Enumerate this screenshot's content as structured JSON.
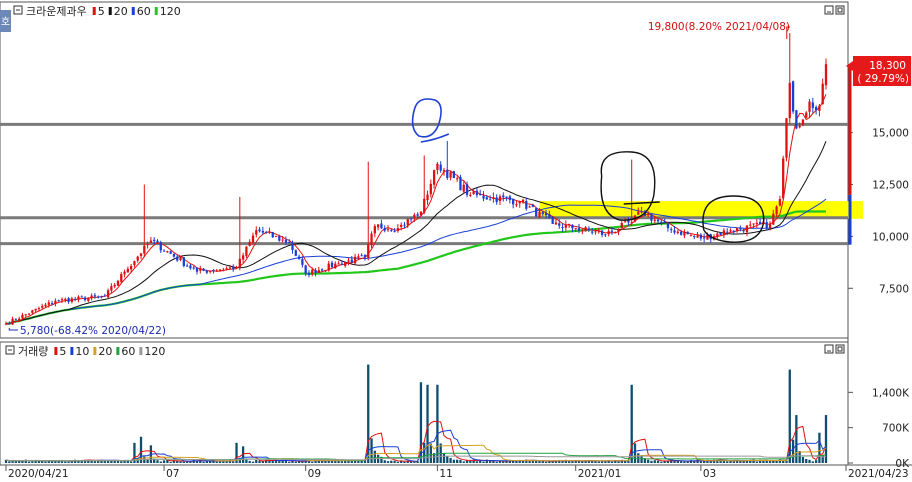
{
  "legend_price": {
    "icon": "collapse-icon",
    "name": "크라운제과우",
    "ma_labels": [
      "5",
      "20",
      "60",
      "120"
    ],
    "ma_colors": [
      "#e01010",
      "#111111",
      "#1a3fd6",
      "#22c71a"
    ]
  },
  "legend_volume": {
    "icon": "collapse-icon",
    "name": "거래량",
    "ma_labels": [
      "5",
      "10",
      "20",
      "60",
      "120"
    ],
    "ma_colors": [
      "#e01010",
      "#1a3fd6",
      "#d8a020",
      "#22a040",
      "#999999"
    ]
  },
  "side_tab": "호",
  "annotations": {
    "high": "19,800(8.20% 2021/04/08)",
    "low": "5,780(-68.42% 2020/04/22)",
    "current_price": "18,300",
    "current_change": "( 29.79%)"
  },
  "colors": {
    "up": "#e01010",
    "down": "#1a3fd6",
    "ma5": "#e01010",
    "ma20": "#111111",
    "ma60": "#1a3fd6",
    "ma120": "#22c71a",
    "hline": "#7a7a7a",
    "highlight": "#ffff00",
    "drawing_black": "#111111",
    "drawing_blue": "#1f3fd6",
    "volume_bar": "#0d4d6e"
  },
  "chart_data": [
    {
      "type": "candlestick",
      "title": "크라운제과우",
      "y_ticks": [
        "15,000",
        "12,500",
        "10,000",
        "7,500"
      ],
      "y_tick_values": [
        15000,
        12500,
        10000,
        7500
      ],
      "ylim": [
        5200,
        21200
      ],
      "x_ticks": [
        "2020/04/21",
        "07",
        "09",
        "11",
        "2021/01",
        "03",
        "2021/04/23"
      ],
      "x_tick_dates": [
        "2020-04-21",
        "2020-07-01",
        "2020-09-01",
        "2020-11-01",
        "2021-01-04",
        "2021-03-02",
        "2021-04-23"
      ],
      "price_keypoints": [
        [
          "2020-04-21",
          5800
        ],
        [
          "2020-05-15",
          6900
        ],
        [
          "2020-06-05",
          7100
        ],
        [
          "2020-06-15",
          8300
        ],
        [
          "2020-06-25",
          9800
        ],
        [
          "2020-07-15",
          8300
        ],
        [
          "2020-07-31",
          8500
        ],
        [
          "2020-08-10",
          10300
        ],
        [
          "2020-08-25",
          9700
        ],
        [
          "2020-09-01",
          8200
        ],
        [
          "2020-09-15",
          8700
        ],
        [
          "2020-09-25",
          9000
        ],
        [
          "2020-10-05",
          10500
        ],
        [
          "2020-10-15",
          10400
        ],
        [
          "2020-10-26",
          11200
        ],
        [
          "2020-11-01",
          13500
        ],
        [
          "2020-11-15",
          12000
        ],
        [
          "2020-12-05",
          11700
        ],
        [
          "2020-12-20",
          10600
        ],
        [
          "2021-01-04",
          10400
        ],
        [
          "2021-01-15",
          10100
        ],
        [
          "2021-01-27",
          10700
        ],
        [
          "2021-02-01",
          11200
        ],
        [
          "2021-02-15",
          10400
        ],
        [
          "2021-03-02",
          9900
        ],
        [
          "2021-03-15",
          10300
        ],
        [
          "2021-03-31",
          10600
        ],
        [
          "2021-04-05",
          11800
        ],
        [
          "2021-04-08",
          17400
        ],
        [
          "2021-04-12",
          15200
        ],
        [
          "2021-04-16",
          16500
        ],
        [
          "2021-04-21",
          16300
        ],
        [
          "2021-04-23",
          18300
        ]
      ],
      "price_spikes": [
        [
          "2020-06-23",
          12500
        ],
        [
          "2020-08-03",
          11900
        ],
        [
          "2020-09-28",
          13600
        ],
        [
          "2020-10-27",
          13900
        ],
        [
          "2020-11-05",
          14600
        ],
        [
          "2021-01-27",
          13700
        ],
        [
          "2021-04-08",
          19800
        ]
      ],
      "horizontal_lines": [
        15400,
        10900,
        9650
      ],
      "highlight_band": {
        "from": 10850,
        "to": 11700,
        "start": "2020-12-15",
        "end": "2021-04-23"
      },
      "extremes": {
        "high": {
          "date": "2021-04-08",
          "value": 19800
        },
        "low": {
          "date": "2020-04-22",
          "value": 5780
        }
      },
      "last": {
        "date": "2021-04-23",
        "value": 18300,
        "change_pct": 29.79
      },
      "moving_averages": [
        "5",
        "20",
        "60",
        "120"
      ]
    },
    {
      "type": "bar",
      "title": "거래량",
      "y_ticks": [
        "1,400K",
        "700K",
        "0K"
      ],
      "y_tick_values": [
        1400,
        700,
        0
      ],
      "ylim": [
        0,
        2100
      ],
      "unit": "K",
      "baseline_k": 45,
      "volume_spikes_k": [
        [
          "2020-06-18",
          400
        ],
        [
          "2020-06-22",
          520
        ],
        [
          "2020-06-25",
          350
        ],
        [
          "2020-07-31",
          400
        ],
        [
          "2020-08-04",
          330
        ],
        [
          "2020-09-28",
          1950
        ],
        [
          "2020-10-26",
          1600
        ],
        [
          "2020-10-28",
          1550
        ],
        [
          "2020-11-02",
          1550
        ],
        [
          "2021-01-27",
          1550
        ],
        [
          "2021-04-08",
          1850
        ],
        [
          "2021-04-12",
          950
        ],
        [
          "2021-04-21",
          600
        ],
        [
          "2021-04-23",
          950
        ]
      ],
      "moving_averages": [
        "5",
        "10",
        "20",
        "60",
        "120"
      ]
    }
  ]
}
